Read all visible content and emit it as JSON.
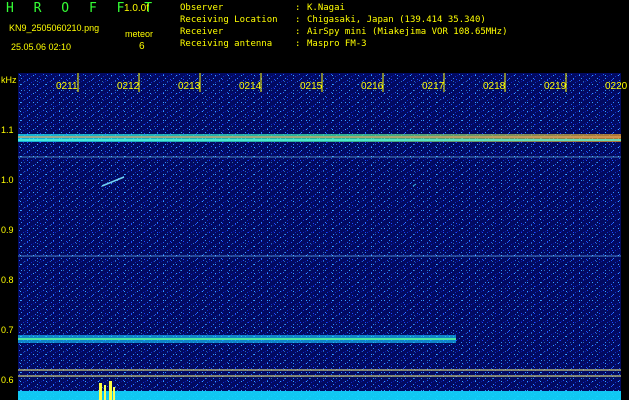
{
  "app": {
    "title": "H R O F F T",
    "version": "1.0.0f",
    "filename": "KN9_2505060210.png",
    "meteor_label": "meteor",
    "timestamp": "25.05.06 02:10",
    "meteor_count": "6"
  },
  "info": [
    {
      "key": "Observer",
      "value": "K.Nagai"
    },
    {
      "key": "Receiving Location",
      "value": "Chigasaki, Japan (139.414 35.340)"
    },
    {
      "key": "Receiver",
      "value": "AirSpy mini (Miakejima VOR 108.65MHz)"
    },
    {
      "key": "Receiving antenna",
      "value": "Maspro FM-3"
    }
  ],
  "axis": {
    "unit": "kHz",
    "time_labels": [
      "0211",
      "0212",
      "0213",
      "0214",
      "0215",
      "0216",
      "0217",
      "0218",
      "0219",
      "0220"
    ],
    "freq_labels": [
      "1.1",
      "1.0",
      "0.9",
      "0.8",
      "0.7",
      "0.6"
    ]
  },
  "colors": {
    "background": "#000000",
    "spectrogram": "#020a61",
    "label": "#ffff00",
    "title": "#35ff35",
    "signal": "#2ff0d0"
  }
}
